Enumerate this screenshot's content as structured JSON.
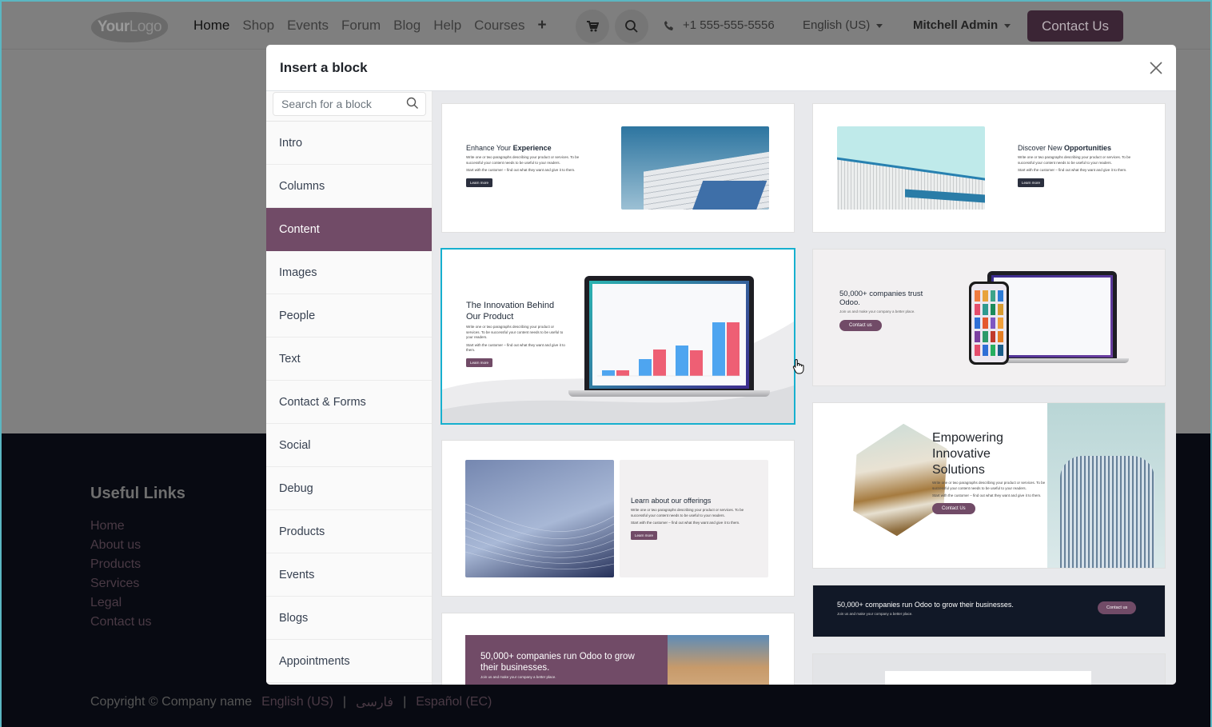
{
  "header": {
    "logo": {
      "bold": "Your",
      "light": "Logo"
    },
    "nav": [
      {
        "label": "Home",
        "active": true
      },
      {
        "label": "Shop"
      },
      {
        "label": "Events"
      },
      {
        "label": "Forum"
      },
      {
        "label": "Blog"
      },
      {
        "label": "Help"
      },
      {
        "label": "Courses"
      }
    ],
    "plus_label": "+",
    "phone": "+1 555-555-5556",
    "language": "English (US)",
    "user": "Mitchell Admin",
    "contact_button": "Contact Us"
  },
  "footer": {
    "useful_links_title": "Useful Links",
    "links": [
      "Home",
      "About us",
      "Products",
      "Services",
      "Legal",
      "Contact us"
    ],
    "copyright": "Copyright © Company name",
    "languages": [
      "English (US)",
      "فارسی",
      "Español (EC)"
    ],
    "separator": "|"
  },
  "modal": {
    "title": "Insert a block",
    "search_placeholder": "Search for a block",
    "categories": [
      {
        "label": "Intro"
      },
      {
        "label": "Columns"
      },
      {
        "label": "Content",
        "active": true
      },
      {
        "label": "Images"
      },
      {
        "label": "People"
      },
      {
        "label": "Text"
      },
      {
        "label": "Contact & Forms"
      },
      {
        "label": "Social"
      },
      {
        "label": "Debug"
      },
      {
        "label": "Products"
      },
      {
        "label": "Events"
      },
      {
        "label": "Blogs"
      },
      {
        "label": "Appointments"
      }
    ],
    "blocks": {
      "enhance": {
        "title_light": "Enhance Your ",
        "title_bold": "Experience",
        "p1": "Write one or two paragraphs describing your product or services. To be successful your content needs to be useful to your readers.",
        "p2": "Start with the customer – find out what they want and give it to them.",
        "button": "Learn more"
      },
      "discover": {
        "title_light": "Discover New ",
        "title_bold": "Opportunities",
        "p1": "Write one or two paragraphs describing your product or services. To be successful your content needs to be useful to your readers.",
        "p2": "Start with the customer – find out what they want and give it to them.",
        "button": "Learn more"
      },
      "innovation": {
        "title": "The Innovation Behind Our Product",
        "p1": "Write one or two paragraphs describing your product or services. To be successful your content needs to be useful to your readers.",
        "p2": "Start with the customer – find out what they want and give it to them.",
        "button": "Learn more",
        "selected": true
      },
      "trust": {
        "title": "50,000+ companies trust Odoo.",
        "p1": "Join us and make your company a better place.",
        "button": "Contact us"
      },
      "offerings": {
        "title": "Learn about our offerings",
        "p1": "Write one or two paragraphs describing your product or services. To be successful your content needs to be useful to your readers.",
        "p2": "Start with the customer – find out what they want and give it to them.",
        "button": "Learn more"
      },
      "empowering": {
        "title": "Empowering Innovative Solutions",
        "p1": "Write one or two paragraphs describing your product or services. To be successful your content needs to be useful to your readers.",
        "p2": "Start with the customer – find out what they want and give it to them.",
        "button": "Contact Us"
      },
      "banner_dark": {
        "title": "50,000+ companies run Odoo to grow their businesses.",
        "p1": "Join us and make your company a better place.",
        "button": "Contact us"
      },
      "banner_purple": {
        "title": "50,000+ companies run Odoo to grow their businesses.",
        "p1": "Join us and make your company a better place."
      }
    }
  },
  "colors": {
    "brand": "#714b67",
    "selection": "#17b0cf",
    "footer_bg": "#080a12",
    "overlay": "#808080"
  }
}
